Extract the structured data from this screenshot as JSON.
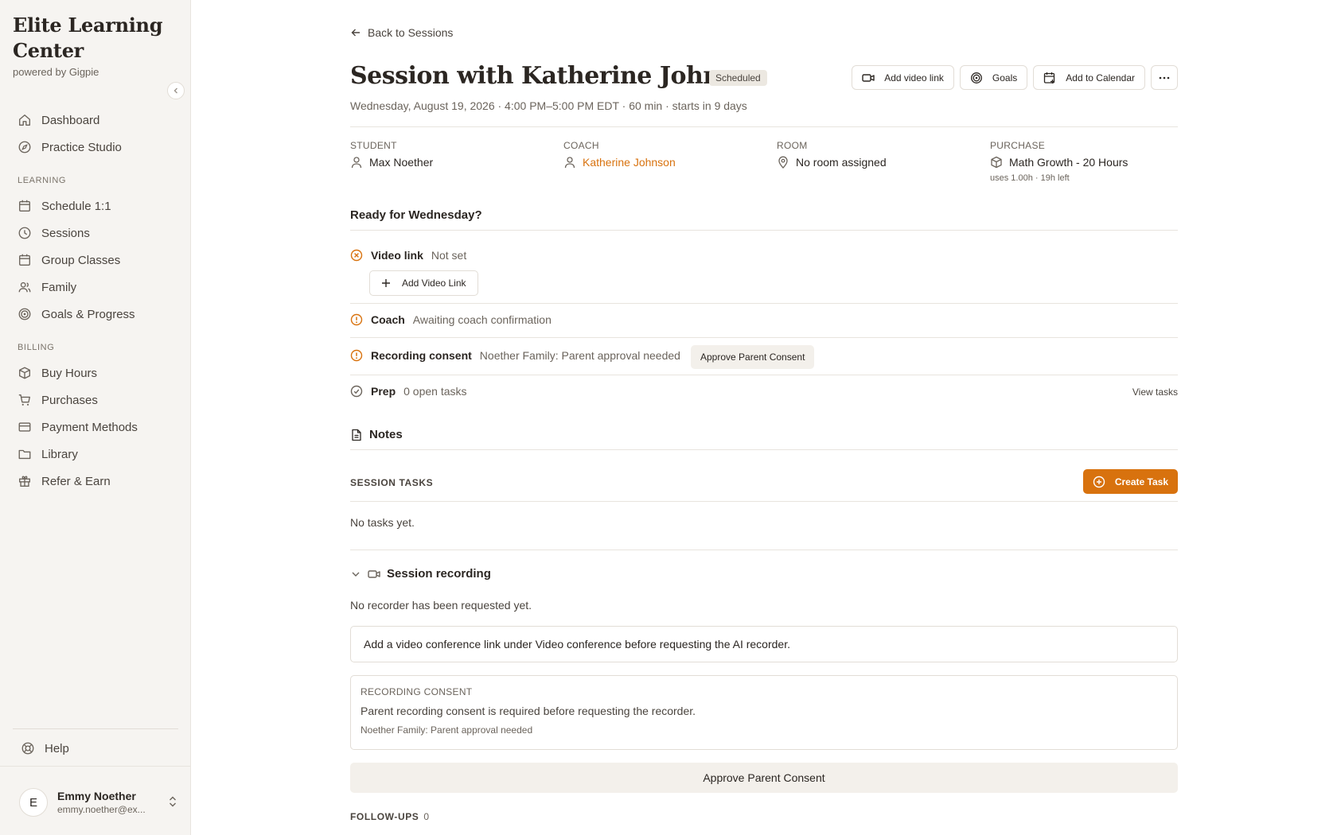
{
  "brand": {
    "title": "Elite Learning Center",
    "subtitle": "powered by Gigpie"
  },
  "sidebar": {
    "top_items": [
      {
        "label": "Dashboard",
        "icon": "home-icon"
      },
      {
        "label": "Practice Studio",
        "icon": "compass-icon"
      }
    ],
    "learning_label": "LEARNING",
    "learning_items": [
      {
        "label": "Schedule 1:1",
        "icon": "calendar-icon"
      },
      {
        "label": "Sessions",
        "icon": "clock-icon"
      },
      {
        "label": "Group Classes",
        "icon": "calendar-icon"
      },
      {
        "label": "Family",
        "icon": "users-icon"
      },
      {
        "label": "Goals & Progress",
        "icon": "target-icon"
      }
    ],
    "billing_label": "BILLING",
    "billing_items": [
      {
        "label": "Buy Hours",
        "icon": "package-icon"
      },
      {
        "label": "Purchases",
        "icon": "cart-icon"
      },
      {
        "label": "Payment Methods",
        "icon": "credit-card-icon"
      },
      {
        "label": "Library",
        "icon": "folder-icon"
      },
      {
        "label": "Refer & Earn",
        "icon": "gift-icon"
      }
    ],
    "help_label": "Help",
    "user": {
      "initial": "E",
      "name": "Emmy Noether",
      "email": "emmy.noether@ex..."
    }
  },
  "header": {
    "back_label": "Back to Sessions",
    "title": "Session with Katherine Johnson",
    "status_badge": "Scheduled",
    "subtitle": "Wednesday, August 19, 2026 · 4:00 PM–5:00 PM EDT · 60 min · starts in 9 days",
    "actions": {
      "video": "Add video link",
      "goals": "Goals",
      "calendar": "Add to Calendar"
    }
  },
  "meta": {
    "student": {
      "label": "STUDENT",
      "value": "Max Noether"
    },
    "coach": {
      "label": "COACH",
      "value": "Katherine Johnson"
    },
    "room": {
      "label": "ROOM",
      "value": "No room assigned"
    },
    "purchase": {
      "label": "PURCHASE",
      "value": "Math Growth - 20 Hours",
      "sub": "uses 1.00h · 19h left"
    }
  },
  "readiness": {
    "title": "Ready for Wednesday?",
    "video": {
      "label": "Video link",
      "desc": "Not set",
      "button": "Add Video Link"
    },
    "coach": {
      "label": "Coach",
      "desc": "Awaiting coach confirmation"
    },
    "consent": {
      "label": "Recording consent",
      "desc": "Noether Family: Parent approval needed",
      "button": "Approve Parent Consent"
    },
    "prep": {
      "label": "Prep",
      "desc": "0 open tasks",
      "link": "View tasks"
    }
  },
  "notes_label": "Notes",
  "tasks": {
    "label": "SESSION TASKS",
    "create": "Create Task",
    "empty": "No tasks yet."
  },
  "recording": {
    "title": "Session recording",
    "status": "No recorder has been requested yet.",
    "info": "Add a video conference link under Video conference before requesting the AI recorder.",
    "consent_title": "RECORDING CONSENT",
    "consent_text": "Parent recording consent is required before requesting the recorder.",
    "consent_sub": "Noether Family: Parent approval needed",
    "approve": "Approve Parent Consent"
  },
  "followups": {
    "label": "FOLLOW-UPS",
    "count": "0"
  },
  "colors": {
    "accent": "#d8720e",
    "sidebar_bg": "#f6f4f1",
    "warning": "#d8720e"
  }
}
